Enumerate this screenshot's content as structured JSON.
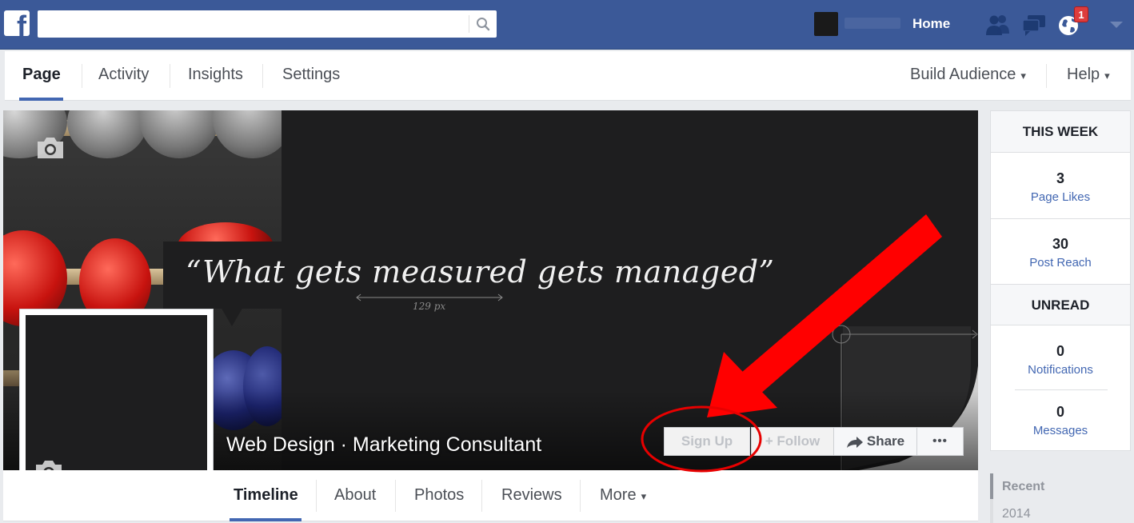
{
  "topbar": {
    "home_label": "Home",
    "notification_count": "1",
    "icons": [
      "facebook-logo",
      "search-icon",
      "friend-requests-icon",
      "messages-icon",
      "notifications-globe-icon",
      "account-menu-caret"
    ]
  },
  "page_nav": {
    "tabs": [
      {
        "label": "Page",
        "active": true
      },
      {
        "label": "Activity"
      },
      {
        "label": "Insights"
      },
      {
        "label": "Settings"
      }
    ],
    "build_audience": "Build Audience",
    "help": "Help",
    "caret": "▾"
  },
  "cover": {
    "quote": "“What gets measured gets managed”",
    "measure_label": "129 px",
    "page_name": "Web Design · Marketing Consultant"
  },
  "actions": {
    "signup": "Sign Up",
    "follow": "Follow",
    "follow_plus": "+",
    "share": "Share",
    "more": "•••"
  },
  "timeline_tabs": [
    {
      "label": "Timeline",
      "active": true
    },
    {
      "label": "About"
    },
    {
      "label": "Photos"
    },
    {
      "label": "Reviews"
    },
    {
      "label": "More"
    }
  ],
  "sidebar": {
    "this_week": "THIS WEEK",
    "page_likes": {
      "num": "3",
      "label": "Page Likes"
    },
    "post_reach": {
      "num": "30",
      "label": "Post Reach"
    },
    "unread": "UNREAD",
    "notifications": {
      "num": "0",
      "label": "Notifications"
    },
    "messages": {
      "num": "0",
      "label": "Messages"
    }
  },
  "timeline_nav": {
    "recent": "Recent",
    "year": "2014"
  },
  "colors": {
    "brand_blue": "#3b5998",
    "link_blue": "#4267b2",
    "annotation_red": "#ff0000"
  }
}
